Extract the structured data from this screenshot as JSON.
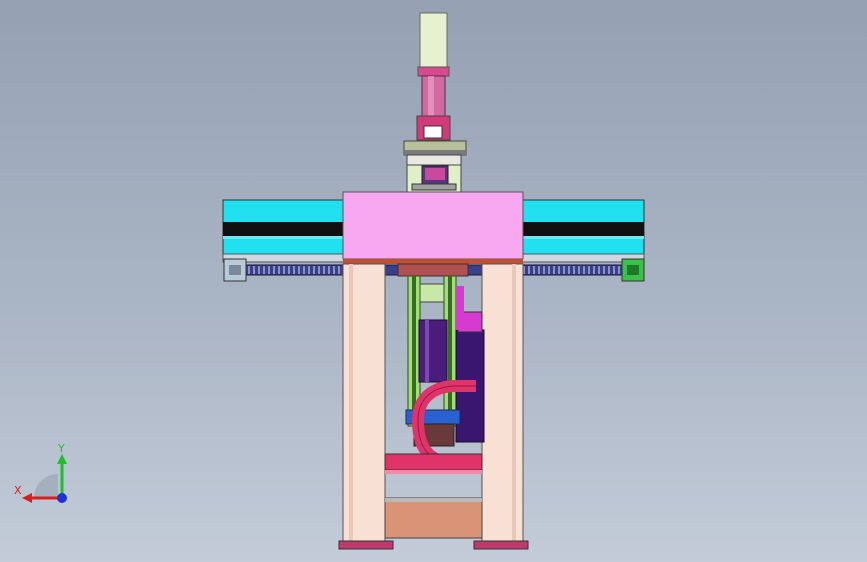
{
  "viewport": {
    "background_top": "#95a1b3",
    "background_bottom": "#c3ccd8"
  },
  "model": {
    "colors": {
      "motor_body": "#e6f2cf",
      "motor_shaft": "#c04a8c",
      "gantry_cyan": "#21e0f0",
      "gantry_black": "#101010",
      "carriage_pink": "#f8a8f0",
      "rack": "#3a3f8a",
      "frame_post": "#f8e0d4",
      "frame_base": "#c0396a",
      "vertical_axis_green": "#9fe070",
      "servo_purple": "#4a1d7a",
      "cable_chain_red": "#e0336a",
      "plate_salmon": "#d99478",
      "end_block_green": "#39c24a"
    }
  },
  "triad": {
    "y_label": "Y",
    "x_label": "X",
    "y_color": "#1fbf2a",
    "x_color": "#d62020",
    "z_color": "#1a35d6"
  }
}
